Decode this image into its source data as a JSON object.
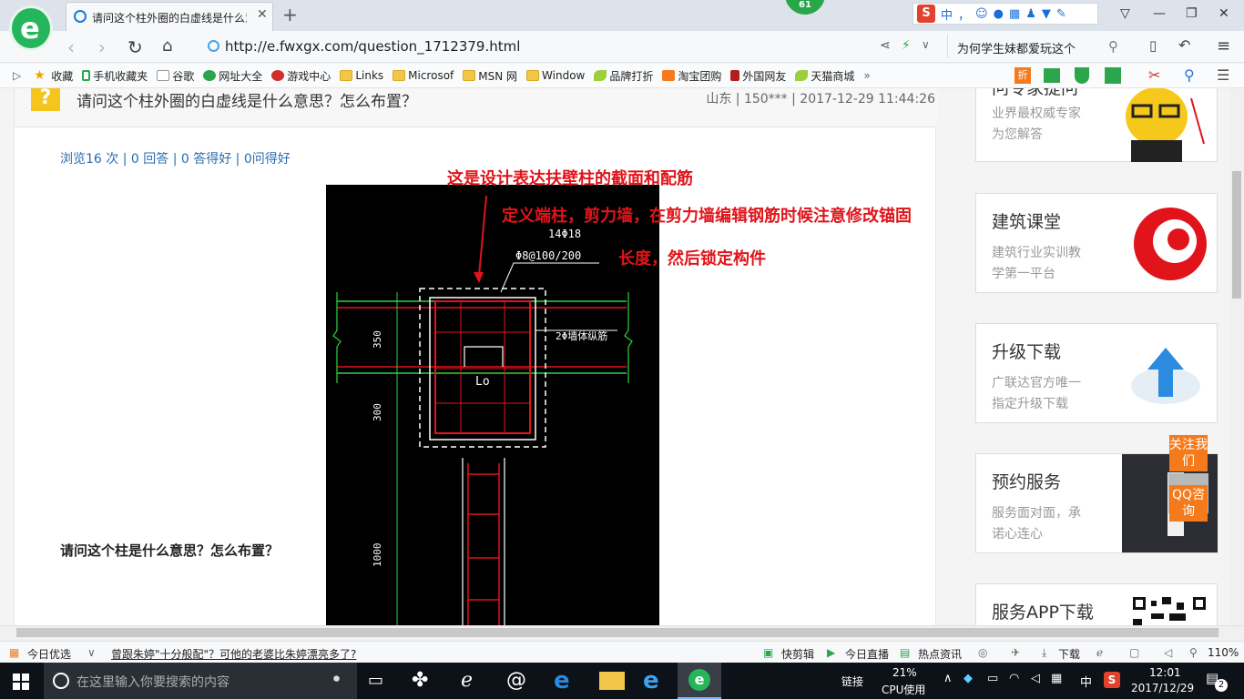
{
  "browser": {
    "tab_title": "请问这个柱外圈的白虚线是什么意思？怎么布置？",
    "badge_count": "61",
    "url": "http://e.fwxgx.com/question_1712379.html",
    "search_text": "为何学生妹都爱玩这个",
    "ime_labels": [
      "中",
      "，",
      "☺"
    ]
  },
  "bookmarks": [
    "收藏",
    "手机收藏夹",
    "谷歌",
    "网址大全",
    "游戏中心",
    "Links",
    "Microsof",
    "MSN 网",
    "Window",
    "品牌打折",
    "淘宝团购",
    "外国网友",
    "天猫商城"
  ],
  "question": {
    "title": "请问这个柱外圈的白虚线是什么意思？怎么布置？",
    "meta": "山东 | 150*** | 2017-12-29 11:44:26",
    "stats": "浏览16 次 | 0 回答 | 0 答得好 | 0问得好",
    "body_text": "请问这个柱是什么意思？怎么布置？"
  },
  "annotations": [
    "这是设计表达扶壁柱的截面和配筋",
    "定义端柱，剪力墙，在剪力墙编辑钢筋时候注意修改锚固",
    "长度，然后锁定构件"
  ],
  "cad": {
    "rebar_label_1": "14Φ18",
    "rebar_label_2": "Φ8@100/200",
    "wall_label": "2Φ墙体纵筋",
    "center_label": "Lo",
    "dim_1": "350",
    "dim_2": "300",
    "dim_3": "1000"
  },
  "sidebar": [
    {
      "title": "问专家提问",
      "line1": "业界最权威专家",
      "line2": "为您解答"
    },
    {
      "title": "建筑课堂",
      "line1": "建筑行业实训教",
      "line2": "学第一平台"
    },
    {
      "title": "升级下载",
      "line1": "广联达官方唯一",
      "line2": "指定升级下载"
    },
    {
      "title": "预约服务",
      "line1": "服务面对面，承",
      "line2": "诺心连心"
    },
    {
      "title": "服务APP下载",
      "line1": "",
      "line2": ""
    }
  ],
  "float_buttons": {
    "follow": "关注我们",
    "qq": "QQ咨询"
  },
  "status_bar": {
    "daily": "今日优选",
    "news": "曾跟朱婷\"十分般配\"？可他的老婆比朱婷漂亮多了?",
    "kuaijianji": "快剪辑",
    "live": "今日直播",
    "hot": "热点资讯",
    "download": "下载",
    "zoom": "110%"
  },
  "taskbar": {
    "search_placeholder": "在这里输入你要搜索的内容",
    "links": "链接",
    "cpu_percent": "21%",
    "cpu_label": "CPU使用",
    "ime": "中",
    "time": "12:01",
    "date": "2017/12/29",
    "notif_count": "2"
  }
}
